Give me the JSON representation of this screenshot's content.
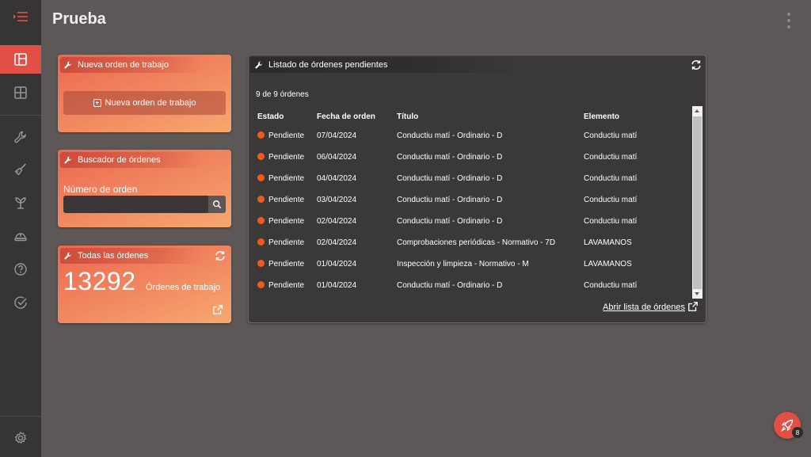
{
  "header": {
    "title": "Prueba"
  },
  "widgets": {
    "new_order": {
      "title": "Nueva orden de trabajo",
      "button_label": "Nueva orden de trabajo"
    },
    "finder": {
      "title": "Buscador de órdenes",
      "field_label": "Número de orden",
      "field_value": ""
    },
    "all_orders": {
      "title": "Todas las órdenes",
      "count": "13292",
      "count_label": "Órdenes de trabajo"
    }
  },
  "pending": {
    "title": "Listado de órdenes pendientes",
    "count_text": "9 de 9 órdenes",
    "columns": [
      "Estado",
      "Fecha de orden",
      "Título",
      "Elemento"
    ],
    "rows": [
      {
        "estado": "Pendiente",
        "fecha": "07/04/2024",
        "titulo": "Conductiu matí - Ordinario - D",
        "elemento": "Conductiu matí"
      },
      {
        "estado": "Pendiente",
        "fecha": "06/04/2024",
        "titulo": "Conductiu matí - Ordinario - D",
        "elemento": "Conductiu matí"
      },
      {
        "estado": "Pendiente",
        "fecha": "04/04/2024",
        "titulo": "Conductiu matí - Ordinario - D",
        "elemento": "Conductiu matí"
      },
      {
        "estado": "Pendiente",
        "fecha": "03/04/2024",
        "titulo": "Conductiu matí - Ordinario - D",
        "elemento": "Conductiu matí"
      },
      {
        "estado": "Pendiente",
        "fecha": "02/04/2024",
        "titulo": "Conductiu matí - Ordinario - D",
        "elemento": "Conductiu matí"
      },
      {
        "estado": "Pendiente",
        "fecha": "02/04/2024",
        "titulo": "Comprobaciones periódicas - Normativo - 7D",
        "elemento": "LAVAMANOS"
      },
      {
        "estado": "Pendiente",
        "fecha": "01/04/2024",
        "titulo": "Inspección y limpieza - Normativo - M",
        "elemento": "LAVAMANOS"
      },
      {
        "estado": "Pendiente",
        "fecha": "01/04/2024",
        "titulo": "Conductiu matí - Ordinario - D",
        "elemento": "Conductiu matí"
      }
    ],
    "open_link": "Abrir lista de órdenes"
  },
  "fab": {
    "badge": "8",
    "icon": "rocket-icon"
  },
  "sidebar": {
    "items": [
      {
        "icon": "dashboard-icon",
        "active": true
      },
      {
        "icon": "grid-icon",
        "active": false
      },
      {
        "icon": "wrench-icon",
        "active": false
      },
      {
        "icon": "brush-icon",
        "active": false
      },
      {
        "icon": "plant-icon",
        "active": false
      },
      {
        "icon": "helmet-icon",
        "active": false
      },
      {
        "icon": "help-icon",
        "active": false
      },
      {
        "icon": "check-circle-icon",
        "active": false
      },
      {
        "icon": "settings-icon",
        "active": false
      }
    ]
  },
  "colors": {
    "accent": "#e14f45",
    "status_pending": "#f05a1e",
    "background": "#5d5857",
    "sidebar": "#363434"
  }
}
